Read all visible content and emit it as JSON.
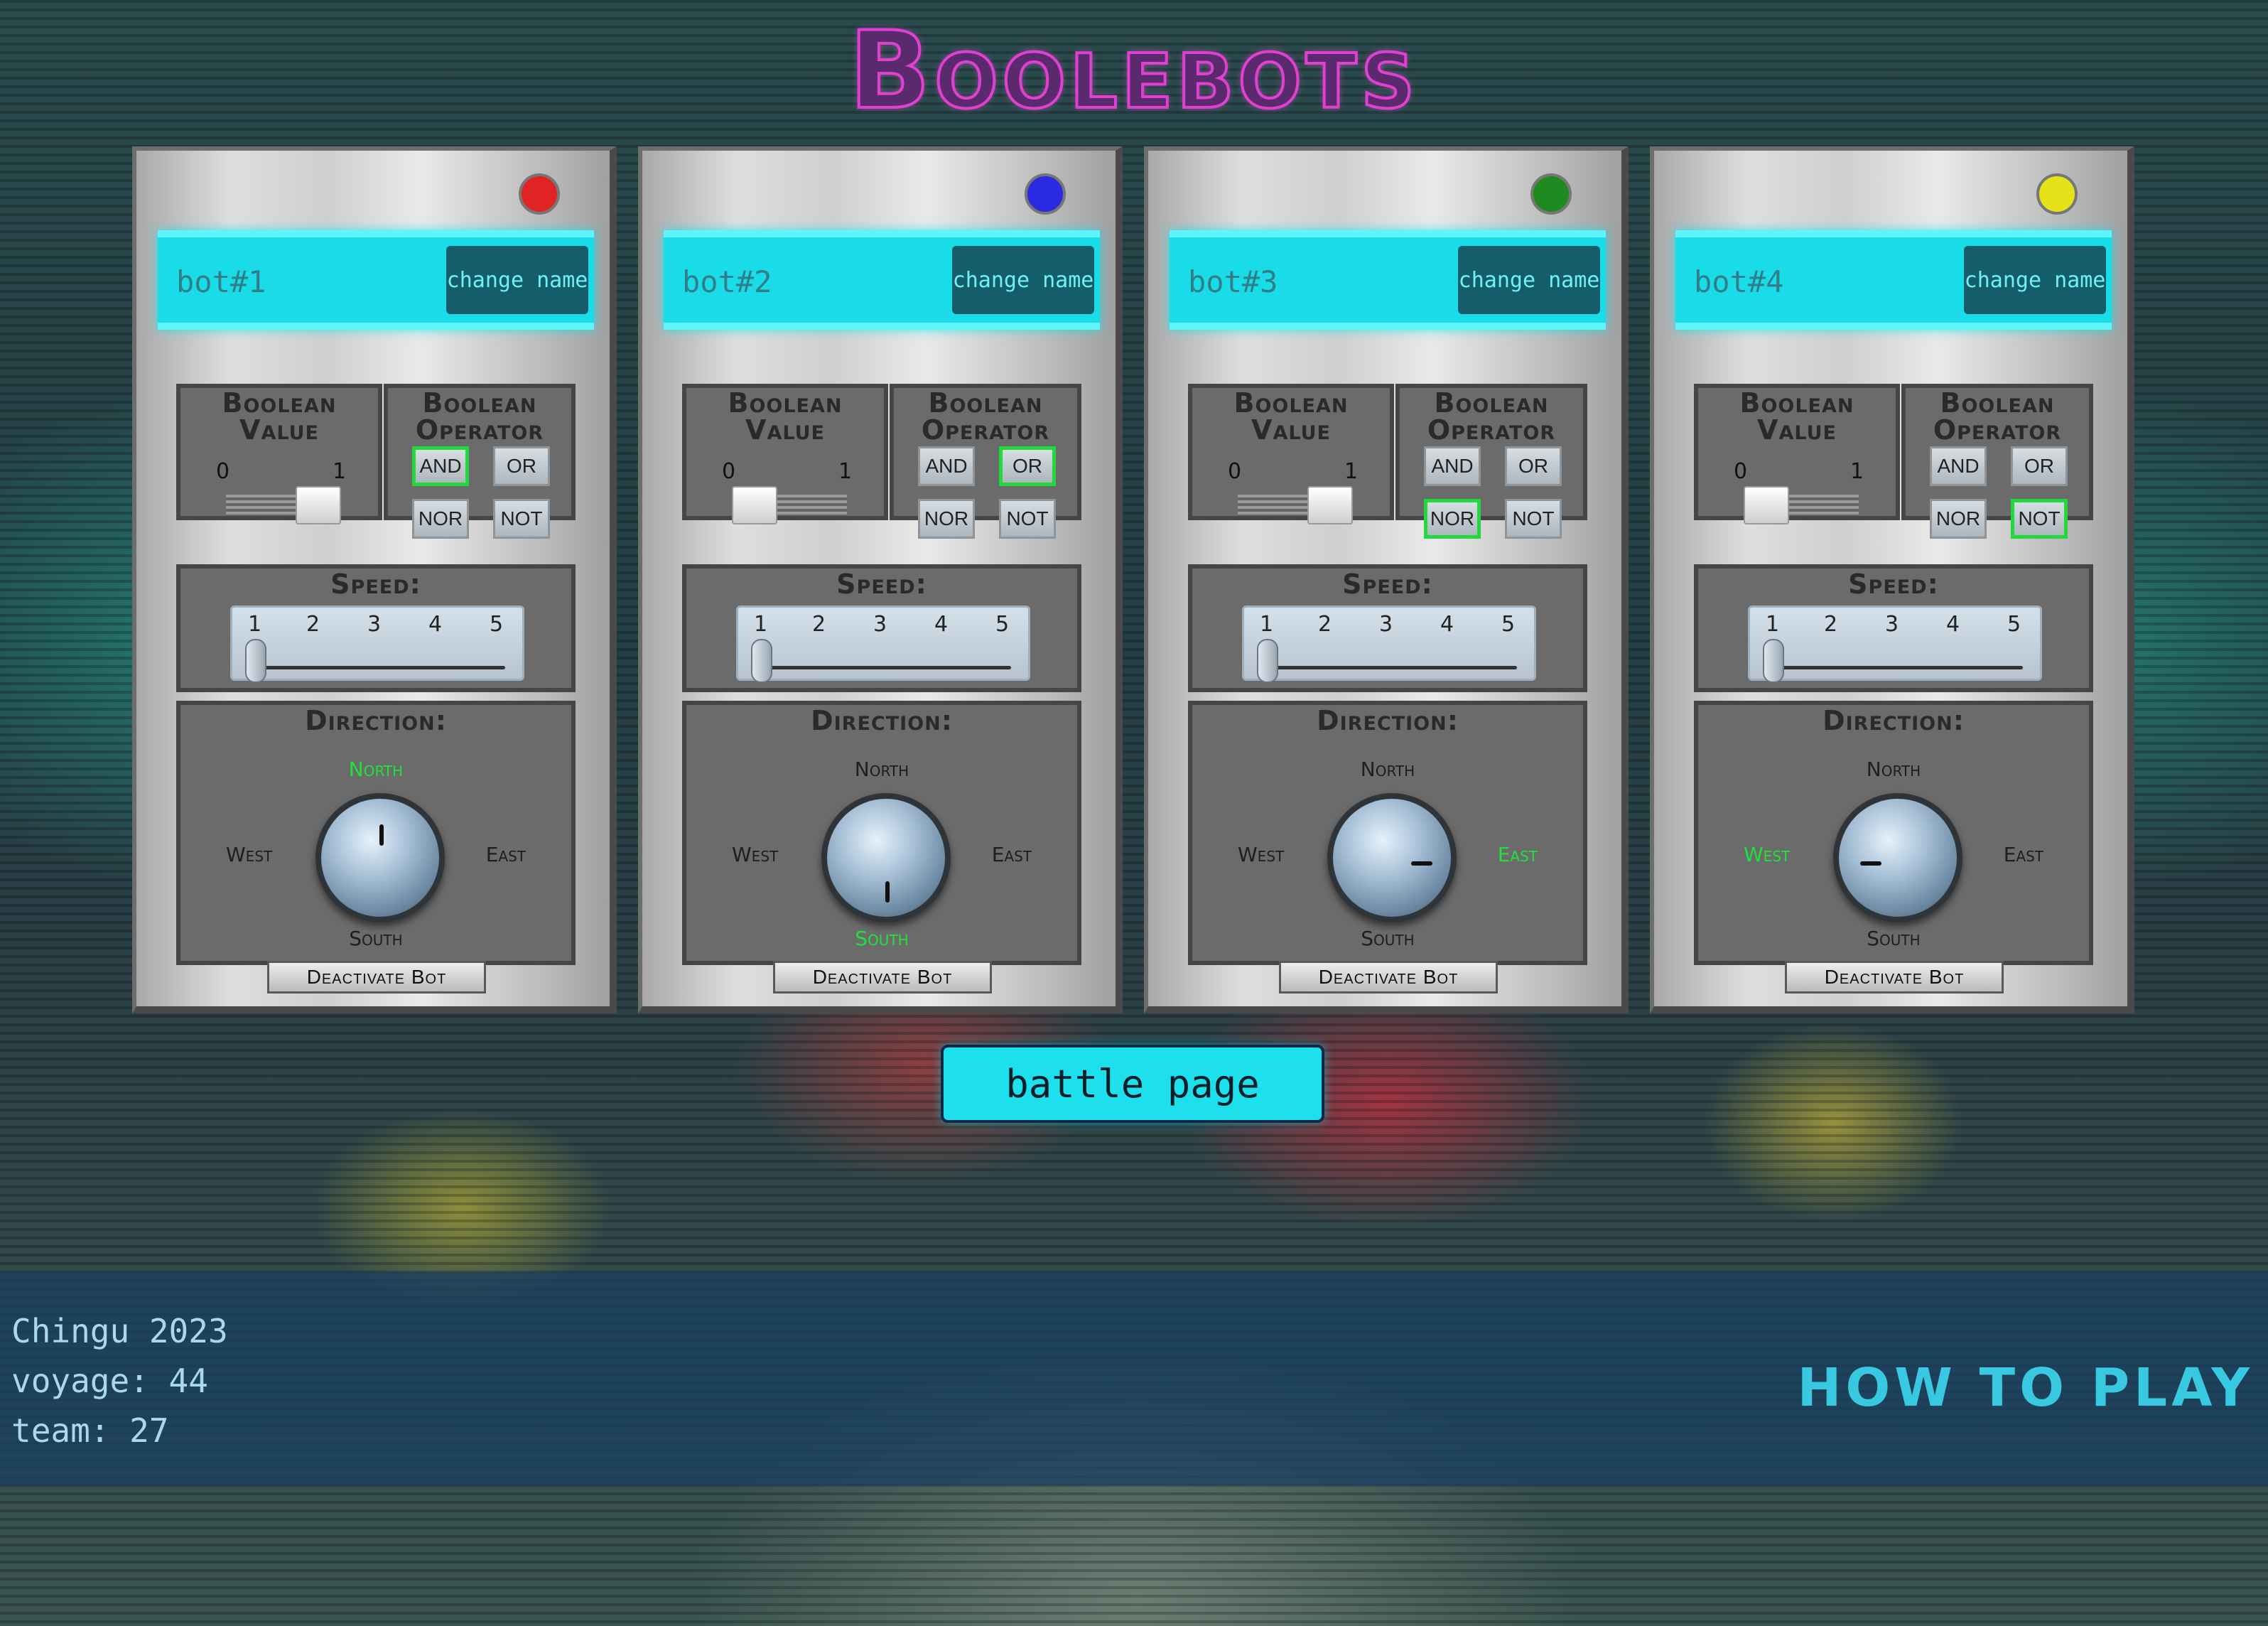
{
  "app": {
    "title": "Boolebots"
  },
  "labels": {
    "change_name": "change name",
    "boolean_value": "Boolean Value",
    "boolean_operator": "Boolean Operator",
    "zero": "0",
    "one": "1",
    "operators": [
      "AND",
      "OR",
      "NOR",
      "NOT"
    ],
    "speed": "Speed:",
    "speed_ticks": [
      "1",
      "2",
      "3",
      "4",
      "5"
    ],
    "direction": "Direction:",
    "north": "North",
    "south": "South",
    "west": "West",
    "east": "East",
    "deactivate": "Deactivate Bot"
  },
  "bots": [
    {
      "name": "bot#1",
      "led_color": "#e02424",
      "boolean_value": 1,
      "operator": "AND",
      "speed": 1,
      "direction": "North"
    },
    {
      "name": "bot#2",
      "led_color": "#2a2ae0",
      "boolean_value": 0,
      "operator": "OR",
      "speed": 1,
      "direction": "South"
    },
    {
      "name": "bot#3",
      "led_color": "#1f8a1f",
      "boolean_value": 1,
      "operator": "NOR",
      "speed": 1,
      "direction": "East"
    },
    {
      "name": "bot#4",
      "led_color": "#e6e21a",
      "boolean_value": 0,
      "operator": "NOT",
      "speed": 1,
      "direction": "West"
    }
  ],
  "actions": {
    "battle_page": "battle page"
  },
  "footer": {
    "line1": "Chingu 2023",
    "line2": "voyage: 44",
    "line3": "team: 27",
    "how_to_play": "HOW TO PLAY"
  },
  "colors": {
    "active": "#22e03c",
    "accent": "#1ee0ec",
    "title": "#e040d0"
  }
}
